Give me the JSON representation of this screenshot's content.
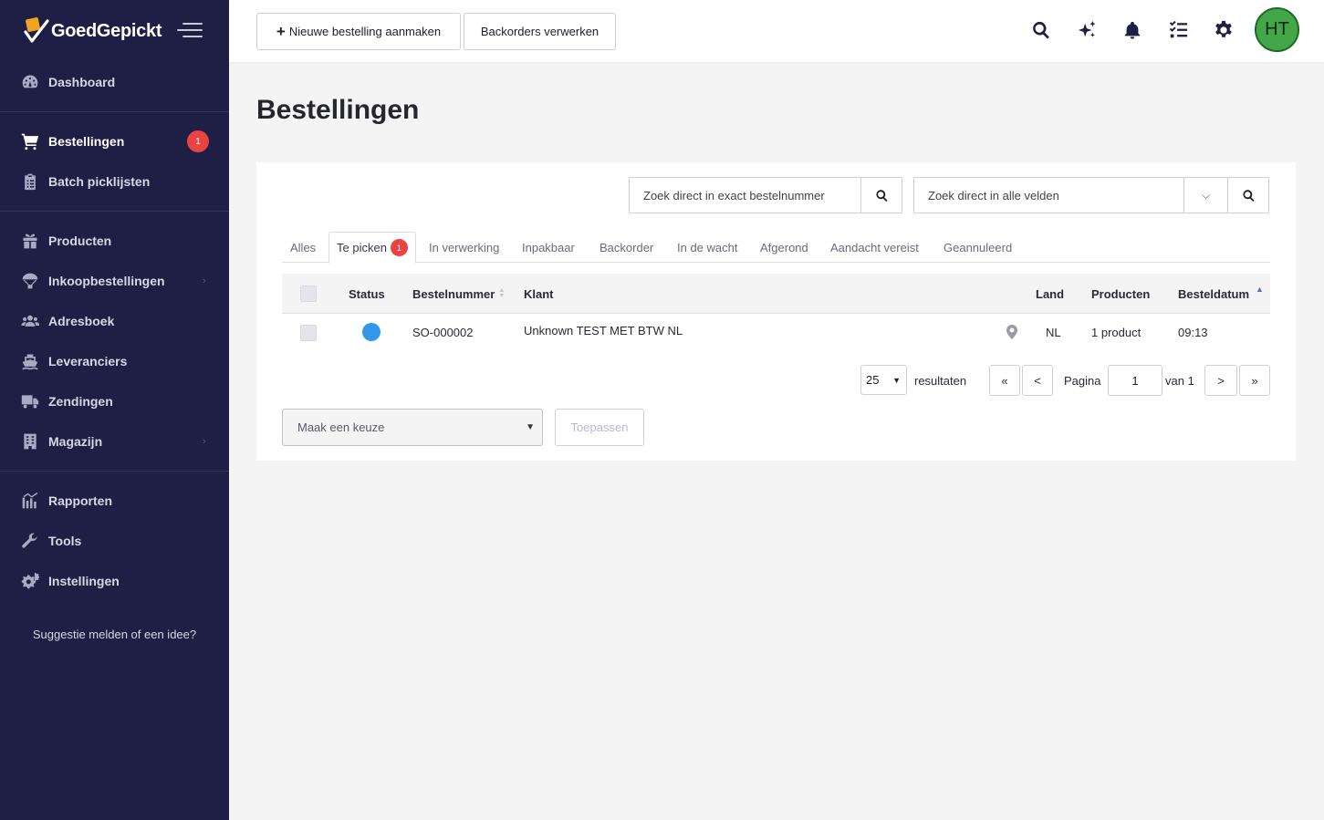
{
  "app": {
    "logo_text": "GoedGepickt"
  },
  "sidebar": {
    "groups": [
      [
        {
          "label": "Dashboard",
          "icon": "dashboard-icon"
        }
      ],
      [
        {
          "label": "Bestellingen",
          "icon": "cart-icon",
          "active": true,
          "badge": "1"
        },
        {
          "label": "Batch picklijsten",
          "icon": "clipboard-icon"
        }
      ],
      [
        {
          "label": "Producten",
          "icon": "gift-icon"
        },
        {
          "label": "Inkoopbestellingen",
          "icon": "parachute-icon",
          "has_children": true
        },
        {
          "label": "Adresboek",
          "icon": "users-icon"
        },
        {
          "label": "Leveranciers",
          "icon": "ship-icon"
        },
        {
          "label": "Zendingen",
          "icon": "truck-icon"
        },
        {
          "label": "Magazijn",
          "icon": "building-icon",
          "has_children": true
        }
      ],
      [
        {
          "label": "Rapporten",
          "icon": "chart-icon"
        },
        {
          "label": "Tools",
          "icon": "wrench-icon"
        },
        {
          "label": "Instellingen",
          "icon": "gears-icon"
        }
      ]
    ],
    "suggestion_link": "Suggestie melden of een idee?"
  },
  "topbar": {
    "new_order_label": "Nieuwe bestelling aanmaken",
    "backorders_label": "Backorders verwerken",
    "avatar_initials": "HT"
  },
  "page": {
    "title": "Bestellingen"
  },
  "search": {
    "exact_placeholder": "Zoek direct in exact bestelnummer",
    "all_placeholder": "Zoek direct in alle velden"
  },
  "tabs": [
    {
      "label": "Alles"
    },
    {
      "label": "Te picken",
      "badge": "1",
      "active": true
    },
    {
      "label": "In verwerking"
    },
    {
      "label": "Inpakbaar"
    },
    {
      "label": "Backorder"
    },
    {
      "label": "In de wacht"
    },
    {
      "label": "Afgerond"
    },
    {
      "label": "Aandacht vereist"
    },
    {
      "label": "Geannuleerd"
    }
  ],
  "table": {
    "columns": {
      "status": "Status",
      "order_number": "Bestelnummer",
      "customer": "Klant",
      "country": "Land",
      "products": "Producten",
      "order_date": "Besteldatum"
    },
    "rows": [
      {
        "status_color": "#3298eb",
        "order_number": "SO-000002",
        "customer": "Unknown TEST MET BTW NL",
        "country": "NL",
        "products": "1 product",
        "order_date": "09:13"
      }
    ]
  },
  "pagination": {
    "per_page": "25",
    "results_label": "resultaten",
    "first": "«",
    "prev": "<",
    "page_label": "Pagina",
    "current_page": "1",
    "of_label": "van 1",
    "next": ">",
    "last": "»"
  },
  "bulk": {
    "select_placeholder": "Maak een keuze",
    "apply_label": "Toepassen"
  },
  "colors": {
    "sidebar_bg": "#1f1f45",
    "badge_red": "#e94343",
    "status_blue": "#3298eb",
    "avatar_green": "#43a74a"
  }
}
